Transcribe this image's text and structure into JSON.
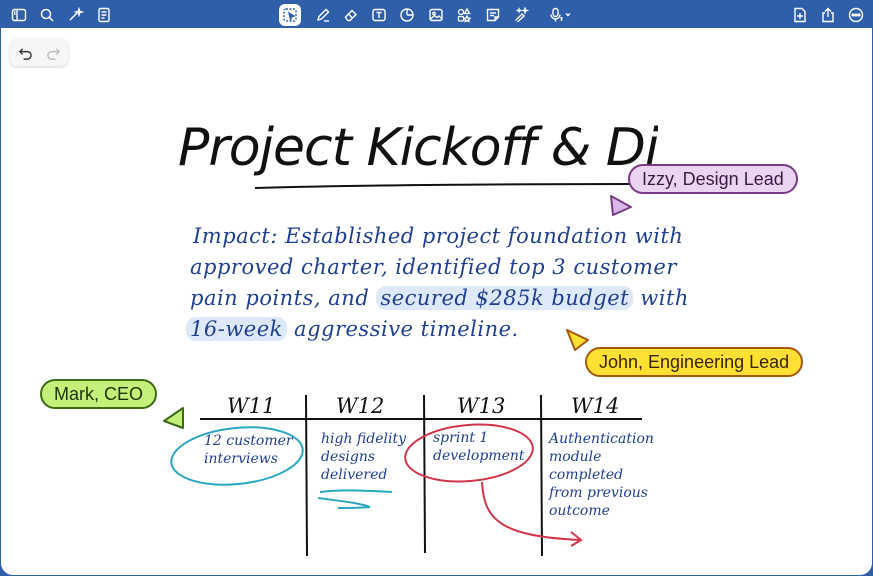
{
  "toolbar": {
    "left_icons": [
      "sidebar-icon",
      "search-icon",
      "sparkle-icon",
      "document-icon"
    ],
    "center_icons": [
      "lasso-select-icon",
      "pen-icon",
      "eraser-icon",
      "text-box-icon",
      "shapes-icon",
      "image-icon",
      "elements-icon",
      "sticky-note-icon",
      "magic-pen-icon",
      "microphone-icon"
    ],
    "right_icons": [
      "add-page-icon",
      "share-icon",
      "more-icon"
    ]
  },
  "undo": {
    "undo_icon": "undo-icon",
    "redo_icon": "redo-icon"
  },
  "note": {
    "title": "Project Kickoff & Discovery",
    "body_lines": [
      {
        "before": "Impact: Established project foundation with",
        "highlight": "",
        "after": ""
      },
      {
        "before": "approved charter, identified top 3 customer",
        "highlight": "",
        "after": ""
      },
      {
        "before": "pain points, and ",
        "highlight": "secured $285k budget",
        "after": " with"
      },
      {
        "before": "",
        "highlight": "16-week",
        "after": " aggressive timeline."
      }
    ],
    "table": {
      "headers": [
        "W11",
        "W12",
        "W13",
        "W14"
      ],
      "cells": [
        [
          "12 customer",
          "interviews"
        ],
        [
          "high fidelity",
          "designs",
          "delivered"
        ],
        [
          "sprint 1",
          "development"
        ],
        [
          "Authentication",
          "module",
          "completed",
          "from previous",
          "outcome"
        ]
      ]
    }
  },
  "collaborators": [
    {
      "name": "Izzy, Design Lead",
      "color": "#ead5f1"
    },
    {
      "name": "John, Engineering Lead",
      "color": "#ffe033"
    },
    {
      "name": "Mark, CEO",
      "color": "#c4f07a"
    }
  ],
  "colors": {
    "toolbar": "#2f5fa8",
    "ink_blue": "#1f3f8f",
    "teal_circle": "#2aa7c0",
    "red_circle": "#d0354a"
  }
}
